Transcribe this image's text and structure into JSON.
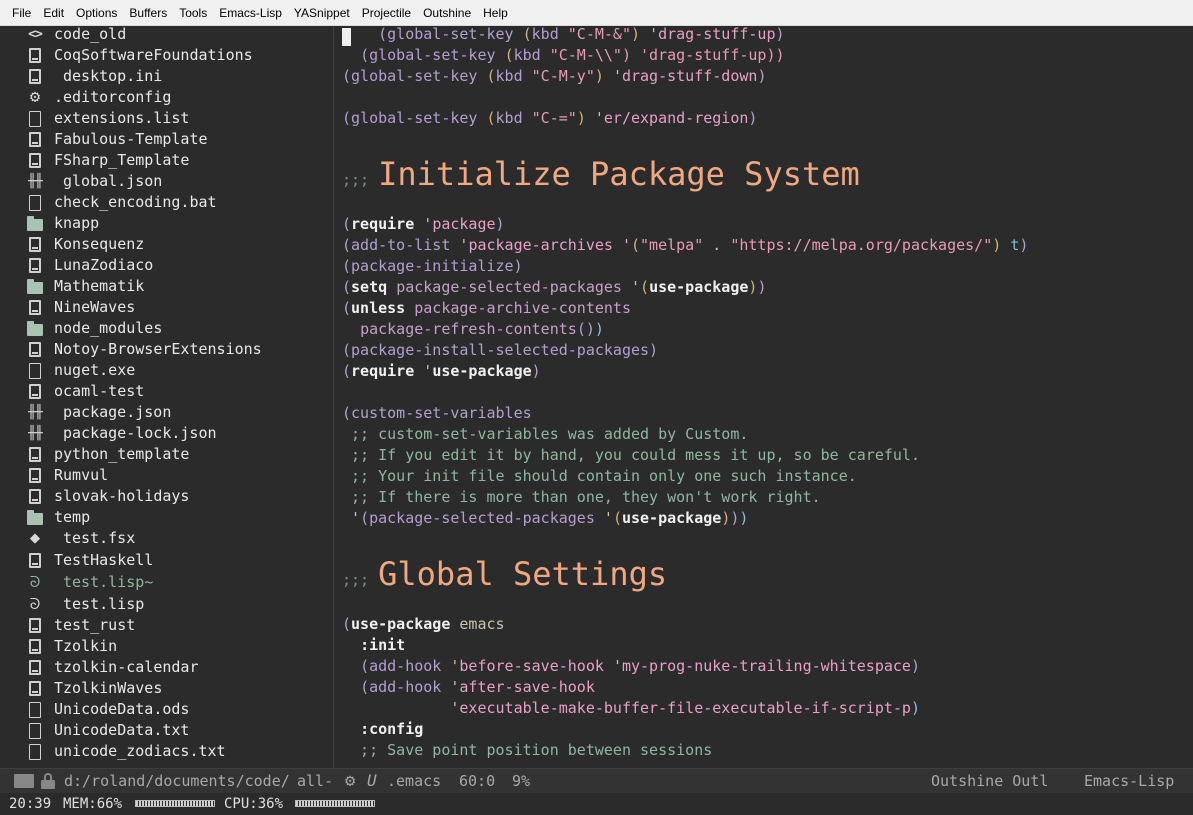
{
  "menu": [
    "File",
    "Edit",
    "Options",
    "Buffers",
    "Tools",
    "Emacs-Lisp",
    "YASnippet",
    "Projectile",
    "Outshine",
    "Help"
  ],
  "sidebar": {
    "items": [
      {
        "label": "code_old",
        "icon": "code-icon"
      },
      {
        "label": "CoqSoftwareFoundations",
        "icon": "repo-icon"
      },
      {
        "label": "desktop.ini",
        "icon": "repo-icon"
      },
      {
        "label": ".editorconfig",
        "icon": "gear-icon"
      },
      {
        "label": "extensions.list",
        "icon": "file-icon"
      },
      {
        "label": "Fabulous-Template",
        "icon": "repo-icon"
      },
      {
        "label": "FSharp_Template",
        "icon": "repo-icon"
      },
      {
        "label": "global.json",
        "icon": "settings-sliders-icon"
      },
      {
        "label": "check_encoding.bat",
        "icon": "file-icon"
      },
      {
        "label": "knapp",
        "icon": "folder-icon"
      },
      {
        "label": "Konsequenz",
        "icon": "repo-icon"
      },
      {
        "label": "LunaZodiaco",
        "icon": "repo-icon"
      },
      {
        "label": "Mathematik",
        "icon": "folder-icon"
      },
      {
        "label": "NineWaves",
        "icon": "repo-icon"
      },
      {
        "label": "node_modules",
        "icon": "folder-icon"
      },
      {
        "label": "Notoy-BrowserExtensions",
        "icon": "repo-icon"
      },
      {
        "label": "nuget.exe",
        "icon": "file-icon"
      },
      {
        "label": "ocaml-test",
        "icon": "repo-icon"
      },
      {
        "label": "package.json",
        "icon": "settings-sliders-icon"
      },
      {
        "label": "package-lock.json",
        "icon": "settings-sliders-icon"
      },
      {
        "label": "python_template",
        "icon": "repo-icon"
      },
      {
        "label": "Rumvul",
        "icon": "repo-icon"
      },
      {
        "label": "slovak-holidays",
        "icon": "repo-icon"
      },
      {
        "label": "temp",
        "icon": "folder-icon"
      },
      {
        "label": "test.fsx",
        "icon": "git-icon"
      },
      {
        "label": "TestHaskell",
        "icon": "repo-icon"
      },
      {
        "label": "test.lisp~",
        "icon": "lisp-icon"
      },
      {
        "label": "test.lisp",
        "icon": "lisp-icon"
      },
      {
        "label": "test_rust",
        "icon": "repo-icon"
      },
      {
        "label": "Tzolkin",
        "icon": "repo-icon"
      },
      {
        "label": "tzolkin-calendar",
        "icon": "repo-icon"
      },
      {
        "label": "TzolkinWaves",
        "icon": "repo-icon"
      },
      {
        "label": "UnicodeData.ods",
        "icon": "file-icon"
      },
      {
        "label": "UnicodeData.txt",
        "icon": "file-icon"
      },
      {
        "label": "unicode_zodiacs.txt",
        "icon": "file-icon"
      }
    ]
  },
  "editor": {
    "lines": [
      "    (global-set-key (kbd \"C-M-&\") 'drag-stuff-up)",
      "  (global-set-key (kbd \"C-M-\\\\\") 'drag-stuff-up))",
      "(global-set-key (kbd \"C-M-y\") 'drag-stuff-down)",
      "",
      "(global-set-key (kbd \"C-=\") 'er/expand-region)",
      ";;; Initialize Package System",
      "(require 'package)",
      "(add-to-list 'package-archives '(\"melpa\" . \"https://melpa.org/packages/\") t)",
      "(package-initialize)",
      "(setq package-selected-packages '(use-package))",
      "(unless package-archive-contents",
      "  package-refresh-contents())",
      "(package-install-selected-packages)",
      "(require 'use-package)",
      "",
      "(custom-set-variables",
      " ;; custom-set-variables was added by Custom.",
      " ;; If you edit it by hand, you could mess it up, so be careful.",
      " ;; Your init file should contain only one such instance.",
      " ;; If there is more than one, they won't work right.",
      " '(package-selected-packages '(use-package)))",
      ";;; Global Settings",
      "(use-package emacs",
      "  :init",
      "  (add-hook 'before-save-hook 'my-prog-nuke-trailing-whitespace)",
      "  (add-hook 'after-save-hook",
      "            'executable-make-buffer-file-executable-if-script-p)",
      "  :config",
      "  ;; Save point position between sessions"
    ]
  },
  "modeline": {
    "path": "d:/roland/documents/code/",
    "project": "all-",
    "buffer": ".emacs",
    "position": "60:0",
    "percent": "9%",
    "minor_mode": "Outshine Outl",
    "major_mode": "Emacs-Lisp"
  },
  "echo": {
    "time": "20:39",
    "mem_label": "MEM:66%",
    "mem_value": 0.66,
    "cpu_label": "CPU:36%",
    "cpu_value": 0.36
  }
}
